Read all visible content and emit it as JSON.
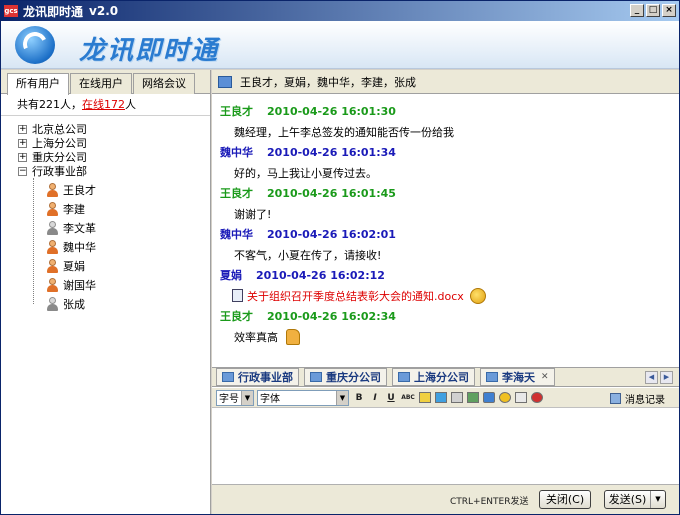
{
  "window": {
    "icon_text": "gcs",
    "title": "龙讯即时通",
    "version": "v2.0",
    "controls": [
      "_",
      "□",
      "×"
    ]
  },
  "banner": {
    "brand": "龙讯即时通"
  },
  "left_panel": {
    "tabs": [
      "所有用户",
      "在线用户",
      "网络会议"
    ],
    "active_tab": "所有用户",
    "count": {
      "prefix": "共有221人，",
      "online": "在线172",
      "suffix": "人"
    },
    "groups": [
      {
        "label": "北京总公司",
        "expand": "+"
      },
      {
        "label": "上海分公司",
        "expand": "+"
      },
      {
        "label": "重庆分公司",
        "expand": "+"
      },
      {
        "label": "行政事业部",
        "expand": "−"
      }
    ],
    "users": [
      {
        "name": "王良才",
        "online": true
      },
      {
        "name": "李建",
        "online": true
      },
      {
        "name": "李文革",
        "online": false
      },
      {
        "name": "魏中华",
        "online": true
      },
      {
        "name": "夏娟",
        "online": true
      },
      {
        "name": "谢国华",
        "online": true
      },
      {
        "name": "张成",
        "online": false
      }
    ]
  },
  "chat": {
    "participants": "王良才，夏娟，魏中华，李建，张成",
    "messages": [
      {
        "name": "王良才",
        "time": "2010-04-26 16:01:30",
        "color": "green",
        "text": "魏经理，上午李总签发的通知能否传一份给我"
      },
      {
        "name": "魏中华",
        "time": "2010-04-26 16:01:34",
        "color": "blue",
        "text": "好的，马上我让小夏传过去。"
      },
      {
        "name": "王良才",
        "time": "2010-04-26 16:01:45",
        "color": "green",
        "text": "谢谢了!"
      },
      {
        "name": "魏中华",
        "time": "2010-04-26 16:02:01",
        "color": "blue",
        "text": "不客气，小夏在传了，请接收!"
      },
      {
        "name": "夏娟",
        "time": "2010-04-26 16:02:12",
        "color": "blue",
        "file": "关于组织召开季度总结表彰大会的通知.docx"
      },
      {
        "name": "王良才",
        "time": "2010-04-26 16:02:34",
        "color": "green",
        "text": "效率真高"
      }
    ],
    "session_tabs": [
      "行政事业部",
      "重庆分公司",
      "上海分公司",
      "李海天"
    ],
    "toolbar": {
      "size_select": "字号",
      "font_select": "字体",
      "bold": "B",
      "italic": "I",
      "underline": "U",
      "abc": "ABC",
      "msg_log": "消息记录"
    },
    "hint": "CTRL+ENTER发送",
    "close_button": "关闭(C)",
    "send_button": "发送(S)"
  },
  "colors": {
    "title_bar": "#0a246a",
    "green_name": "#1a9a1a",
    "blue_name": "#1a1ab8",
    "file_link": "#dd0000"
  }
}
